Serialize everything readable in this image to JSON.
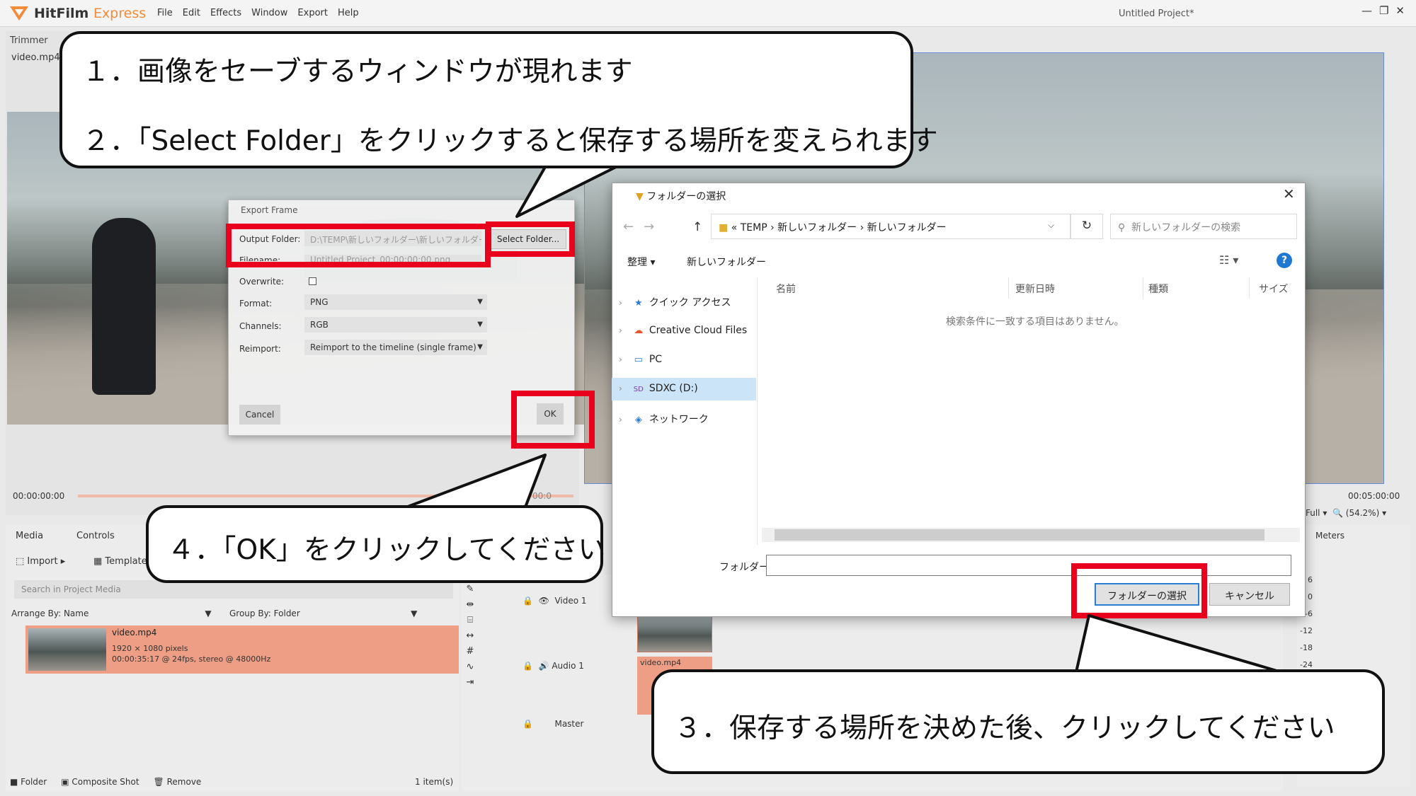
{
  "app": {
    "name_main": "HitFilm",
    "name_edition": "Express",
    "project_title": "Untitled Project*",
    "menu": [
      "File",
      "Edit",
      "Effects",
      "Window",
      "Export",
      "Help"
    ],
    "window_controls": [
      "—",
      "❐",
      "✕"
    ]
  },
  "trimmer": {
    "tab": "Trimmer",
    "file": "video.mp4",
    "time_start": "00:00:00:00",
    "time_mid": "00:0",
    "time_end_short": ":35:17",
    "time_end": "00:05:00:00",
    "quality": "Full",
    "zoom": "(54.2%)"
  },
  "media": {
    "tab": "Media",
    "controls_tab": "Controls",
    "import": "Import",
    "templates": "Template",
    "search_placeholder": "Search in Project Media",
    "arrange": "Arrange By: Name",
    "group": "Group By: Folder",
    "item_name": "video.mp4",
    "item_res": "1920 × 1080 pixels",
    "item_info": "00:00:35:17 @ 24fps, stereo @ 48000Hz",
    "footer": [
      "Folder",
      "Composite Shot",
      "Remove"
    ],
    "count": "1 item(s)"
  },
  "timeline": {
    "tracks": [
      "Video 1",
      "Audio 1",
      "Master"
    ],
    "clip_label": "video.mp4",
    "meters": "Meters",
    "meter_scale": [
      "6",
      "0",
      "-6",
      "-12",
      "-18",
      "-24"
    ]
  },
  "export_frame": {
    "title": "Export Frame",
    "output_folder_label": "Output Folder:",
    "output_folder_value": "D:\\TEMP\\新しいフォルダー\\新しいフォルダー",
    "filename_label": "Filename:",
    "filename_value": "Untitled Project_00;00;00;00.png",
    "select_folder": "Select Folder...",
    "overwrite_label": "Overwrite:",
    "format_label": "Format:",
    "format_value": "PNG",
    "channels_label": "Channels:",
    "channels_value": "RGB",
    "reimport_label": "Reimport:",
    "reimport_value": "Reimport to the timeline (single frame)",
    "cancel": "Cancel",
    "ok": "OK"
  },
  "folder_dialog": {
    "title": "フォルダーの選択",
    "address": [
      "«",
      "TEMP",
      "›",
      "新しいフォルダー",
      "›",
      "新しいフォルダー"
    ],
    "search_placeholder": "新しいフォルダーの検索",
    "organize": "整理 ▾",
    "new_folder": "新しいフォルダー",
    "tree": [
      "クイック アクセス",
      "Creative Cloud Files",
      "PC",
      "SDXC (D:)",
      "ネットワーク"
    ],
    "columns": [
      "名前",
      "更新日時",
      "種類",
      "サイズ"
    ],
    "empty_message": "検索条件に一致する項目はありません。",
    "folder_label": "フォルダー:",
    "folder_value": "",
    "select_button": "フォルダーの選択",
    "cancel_button": "キャンセル"
  },
  "callouts": {
    "step1": "１．画像をセーブするウィンドウが現れます",
    "step2": "２．「Select Folder」をクリックすると保存する場所を変えられます",
    "step3": "３．保存する場所を決めた後、クリックしてください",
    "step4": "４．「OK」をクリックしてください"
  },
  "colors": {
    "accent_orange": "#f28c3a",
    "highlight_red": "#e8001c",
    "media_item": "#ee9e84",
    "windows_blue": "#2b7dd2"
  }
}
